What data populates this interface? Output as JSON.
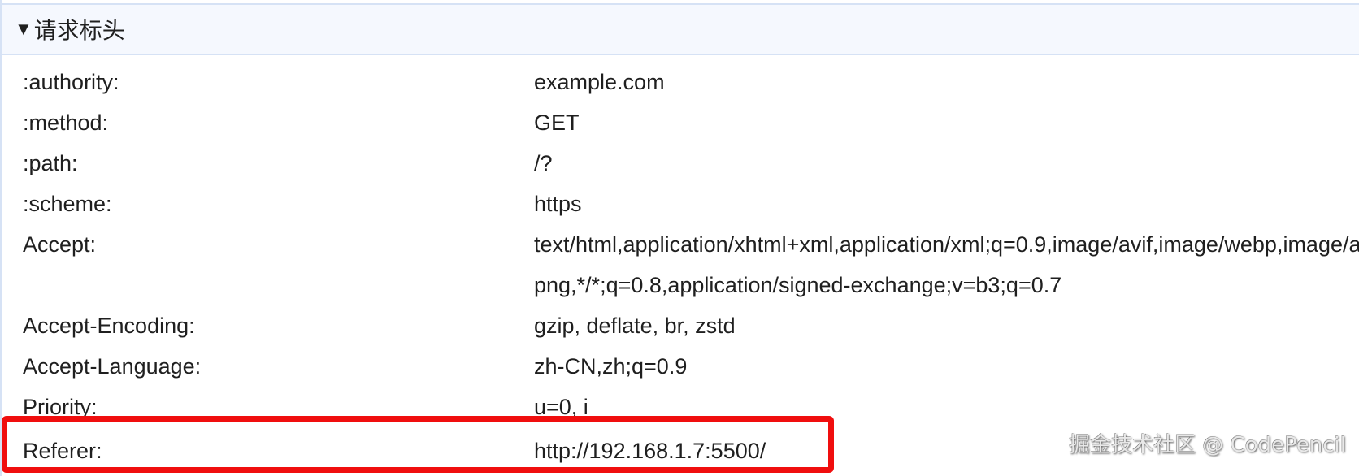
{
  "section": {
    "title": "请求标头",
    "expanded": true
  },
  "headers": [
    {
      "key": ":authority:",
      "value": "example.com"
    },
    {
      "key": ":method:",
      "value": "GET"
    },
    {
      "key": ":path:",
      "value": "/?"
    },
    {
      "key": ":scheme:",
      "value": "https"
    },
    {
      "key": "Accept:",
      "value": "text/html,application/xhtml+xml,application/xml;q=0.9,image/avif,image/webp,image/apng,*/*;q=0.8,application/signed-exchange;v=b3;q=0.7"
    },
    {
      "key": "Accept-Encoding:",
      "value": "gzip, deflate, br, zstd"
    },
    {
      "key": "Accept-Language:",
      "value": "zh-CN,zh;q=0.9"
    },
    {
      "key": "Priority:",
      "value": "u=0, i"
    },
    {
      "key": "Referer:",
      "value": "http://192.168.1.7:5500/"
    }
  ],
  "watermark": "掘金技术社区 @ CodePencil",
  "colors": {
    "highlight": "#f00e0e",
    "header_bg": "#f5f8fe",
    "border": "#d6e2f5"
  }
}
